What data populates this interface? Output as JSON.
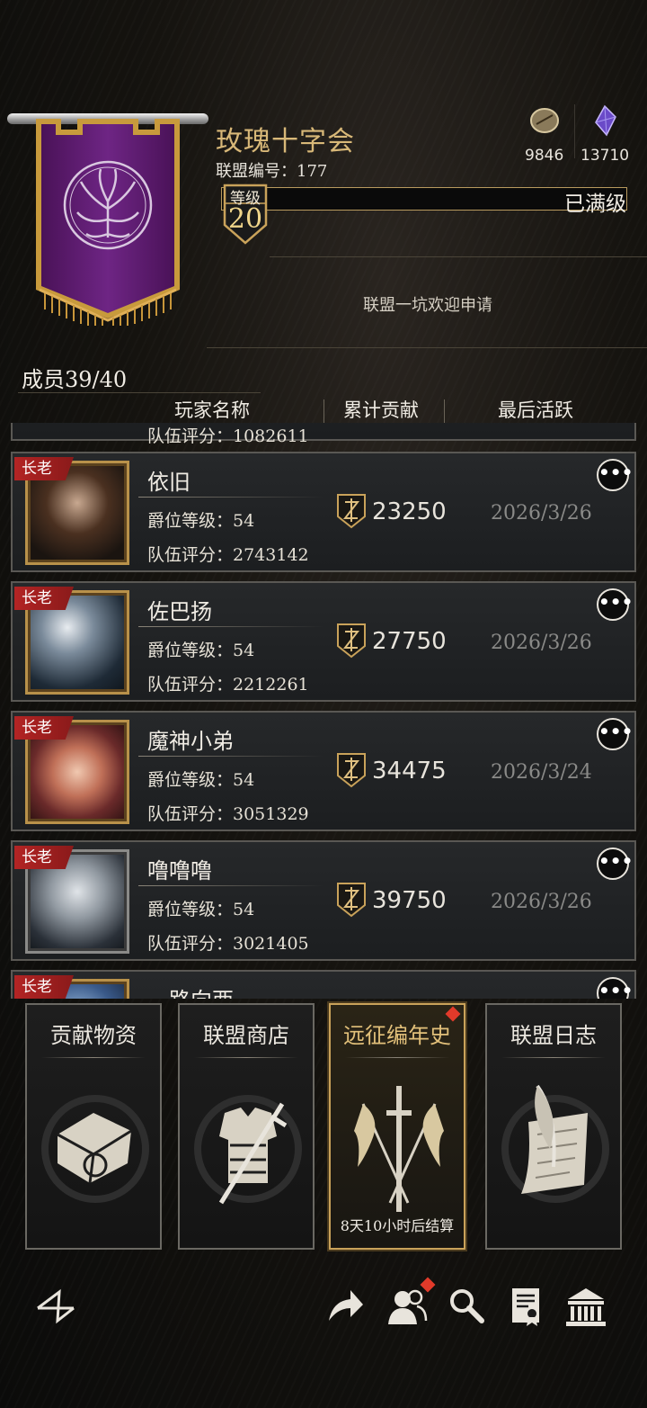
{
  "alliance": {
    "name": "玫瑰十字会",
    "number_label": "联盟编号：177",
    "level_label": "等级",
    "level": "20",
    "level_status": "已满级",
    "motto": "联盟一坑欢迎申请"
  },
  "resources": [
    {
      "icon": "coin-icon",
      "value": "9846"
    },
    {
      "icon": "crystal-icon",
      "value": "13710"
    }
  ],
  "members": {
    "count_label": "成员39/40",
    "headers": [
      "玩家名称",
      "累计贡献",
      "最后活跃"
    ],
    "partial_top_text": "队伍评分：1082611",
    "rows": [
      {
        "rank": "长老",
        "name": "依旧",
        "noble_level": "爵位等级：54",
        "team_score": "队伍评分：2743142",
        "contribution": "23250",
        "last_active": "2026/3/26"
      },
      {
        "rank": "长老",
        "name": "佐巴扬",
        "noble_level": "爵位等级：54",
        "team_score": "队伍评分：2212261",
        "contribution": "27750",
        "last_active": "2026/3/26"
      },
      {
        "rank": "长老",
        "name": "魔神小弟",
        "noble_level": "爵位等级：54",
        "team_score": "队伍评分：3051329",
        "contribution": "34475",
        "last_active": "2026/3/24"
      },
      {
        "rank": "长老",
        "name": "噜噜噜",
        "noble_level": "爵位等级：54",
        "team_score": "队伍评分：3021405",
        "contribution": "39750",
        "last_active": "2026/3/26"
      },
      {
        "rank": "长老",
        "name": "一路向西",
        "noble_level": "",
        "team_score": "",
        "contribution": "",
        "last_active": ""
      }
    ]
  },
  "cards": [
    {
      "title": "贡献物资",
      "footer": ""
    },
    {
      "title": "联盟商店",
      "footer": ""
    },
    {
      "title": "远征编年史",
      "footer": "8天10小时后结算"
    },
    {
      "title": "联盟日志",
      "footer": ""
    }
  ],
  "colors": {
    "gold": "#d9b36a",
    "rank_red": "#b32424",
    "banner_purple": "#5a1a6a"
  }
}
